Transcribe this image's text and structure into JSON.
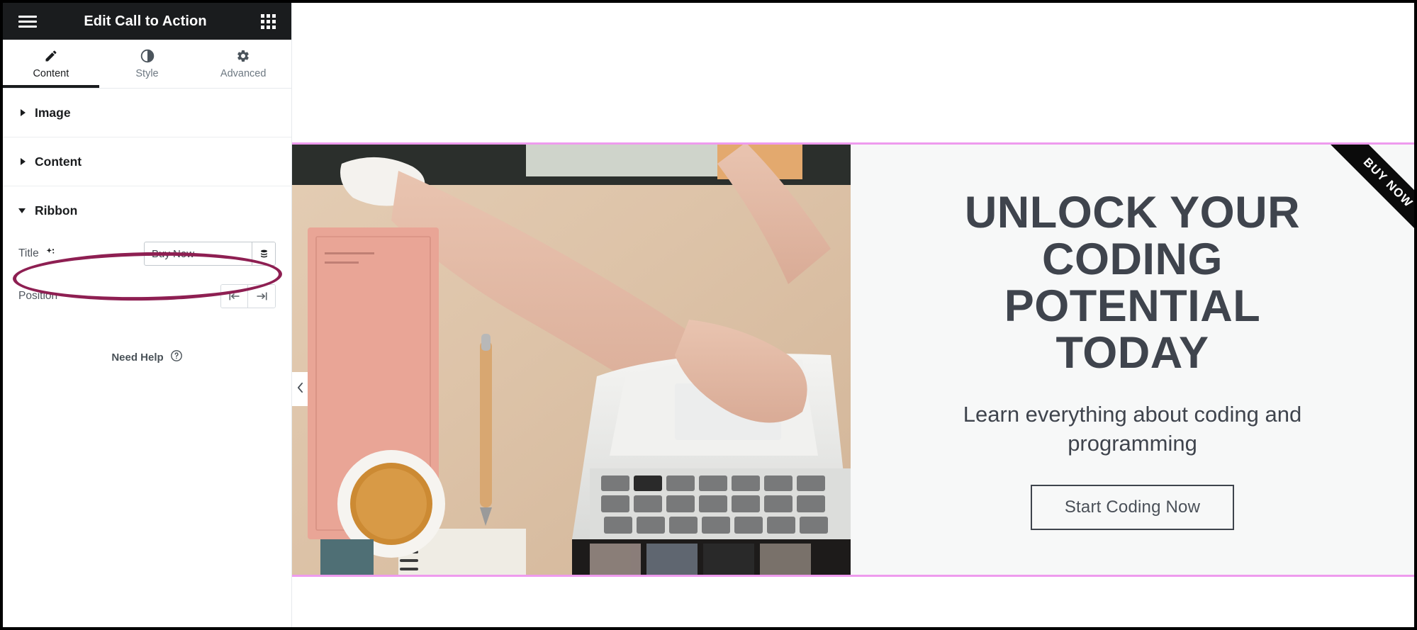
{
  "panel": {
    "header": {
      "title": "Edit Call to Action",
      "menu_icon": "hamburger-icon",
      "apps_icon": "grid-apps-icon"
    },
    "tabs": [
      {
        "label": "Content",
        "icon": "pencil-icon",
        "active": true
      },
      {
        "label": "Style",
        "icon": "contrast-half-circle-icon",
        "active": false
      },
      {
        "label": "Advanced",
        "icon": "gear-icon",
        "active": false
      }
    ],
    "sections": [
      {
        "label": "Image",
        "expanded": false
      },
      {
        "label": "Content",
        "expanded": false
      },
      {
        "label": "Ribbon",
        "expanded": true
      }
    ],
    "ribbon_section": {
      "title_control": {
        "label": "Title",
        "ai_icon": "sparkle-ai-icon",
        "value": "Buy Now",
        "placeholder": "",
        "dynamic_tag_icon": "database-stack-icon"
      },
      "position_control": {
        "label": "Position",
        "options": [
          {
            "icon": "align-left-icon",
            "value": "left",
            "selected": false
          },
          {
            "icon": "align-right-icon",
            "value": "right",
            "selected": false
          }
        ]
      }
    },
    "need_help": {
      "label": "Need Help",
      "icon": "question-circle-icon"
    }
  },
  "preview": {
    "collapse_handle_icon": "chevron-left-icon",
    "cta": {
      "ribbon_text": "BUY NOW",
      "title": "Unlock Your Coding Potential Today",
      "description": "Learn everything about coding and programming",
      "button_label": "Start Coding Now",
      "image_alt": "hands-typing-on-laptop-photo"
    }
  },
  "colors": {
    "panel_header_bg": "#1a1c1e",
    "accent_border": "#ee9bee",
    "annotation": "#8e1f52",
    "heading_text": "#3f444d",
    "cta_bg": "#f7f8f8",
    "ribbon_bg": "#0b0b0b"
  }
}
